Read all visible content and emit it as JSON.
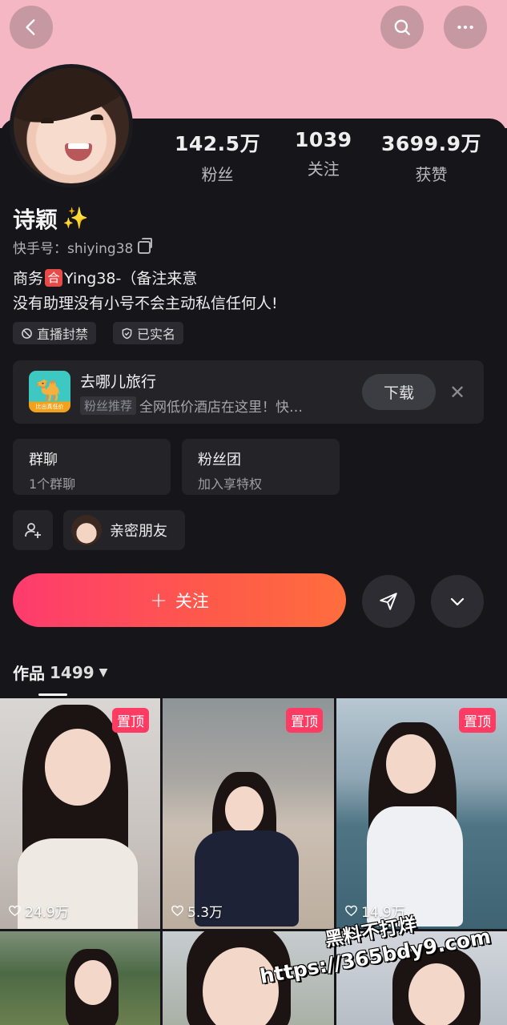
{
  "profile": {
    "name": "诗颖",
    "name_emoji": "✨",
    "kuaishou_id": "快手号：shiying38",
    "bio_prefix": "商务",
    "bio_badge": "合",
    "bio_suffix": "Ying38-（备注来意",
    "bio_line2": "没有助理没有小号不会主动私信任何人!"
  },
  "stats": [
    {
      "value": "142.5万",
      "label": "粉丝"
    },
    {
      "value": "1039",
      "label": "关注"
    },
    {
      "value": "3699.9万",
      "label": "获赞"
    }
  ],
  "tags": [
    {
      "label": "直播封禁",
      "icon": "ban-icon"
    },
    {
      "label": "已实名",
      "icon": "shield-check-icon"
    }
  ],
  "ad": {
    "title": "去哪儿旅行",
    "chip": "粉丝推荐",
    "desc": "全网低价酒店在这里！快…",
    "logo_text": "比出真低价",
    "download": "下载"
  },
  "groups": [
    {
      "title": "群聊",
      "sub": "1个群聊"
    },
    {
      "title": "粉丝团",
      "sub": "加入享特权"
    }
  ],
  "close_friend": {
    "label": "亲密朋友"
  },
  "follow": {
    "label": "关注"
  },
  "works": {
    "label": "作品",
    "count": "1499"
  },
  "thumbnails": [
    {
      "pinned": "置顶",
      "likes": "24.9万"
    },
    {
      "pinned": "置顶",
      "likes": "5.3万"
    },
    {
      "pinned": "置顶",
      "likes": "14.9万"
    }
  ],
  "watermark": {
    "line1": "黑料不打烊",
    "line2": "https://365bdy9.com"
  },
  "colors": {
    "banner": "#f4b7c3",
    "accent": "#fe3b6e",
    "background": "#16161a"
  }
}
